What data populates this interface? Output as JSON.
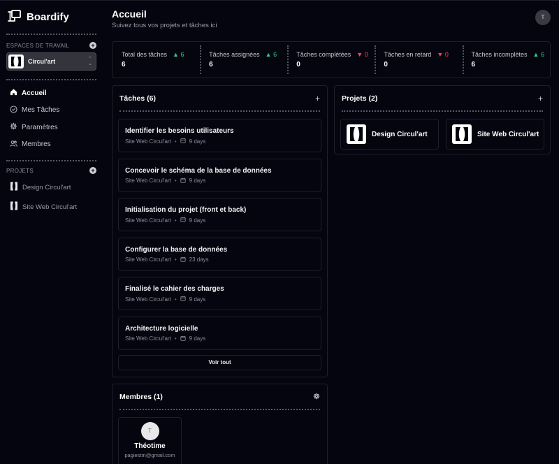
{
  "app": {
    "name": "Boardify"
  },
  "sidebar": {
    "workspaces_label": "ESPACES DE TRAVAIL",
    "workspace": {
      "name": "Circul'art",
      "chevron": "⌃⌄"
    },
    "nav": [
      {
        "label": "Accueil",
        "icon": "home-icon",
        "active": true
      },
      {
        "label": "Mes Tâches",
        "icon": "check-circle-icon",
        "active": false
      },
      {
        "label": "Paramètres",
        "icon": "gear-icon",
        "active": false
      },
      {
        "label": "Membres",
        "icon": "users-icon",
        "active": false
      }
    ],
    "projects_label": "PROJETS",
    "projects": [
      {
        "label": "Design Circul'art"
      },
      {
        "label": "Site Web Circul'art"
      }
    ]
  },
  "header": {
    "title": "Accueil",
    "subtitle": "Suivez tous vos projets et tâches ici",
    "avatar_initial": "T"
  },
  "stats": [
    {
      "label": "Total des tâches",
      "delta": "6",
      "trend": "up",
      "value": "6"
    },
    {
      "label": "Tâches assignées",
      "delta": "6",
      "trend": "up",
      "value": "6"
    },
    {
      "label": "Tâches complétées",
      "delta": "0",
      "trend": "down",
      "value": "0"
    },
    {
      "label": "Tâches en retard",
      "delta": "0",
      "trend": "down",
      "value": "0"
    },
    {
      "label": "Tâches incomplètes",
      "delta": "6",
      "trend": "up",
      "value": "6"
    }
  ],
  "tasks_panel": {
    "title": "Tâches (6)",
    "see_all": "Voir tout",
    "tasks": [
      {
        "title": "Identifier les besoins utilisateurs",
        "project": "Site Web Circul'art",
        "due": "9 days"
      },
      {
        "title": "Concevoir le schéma de la base de données",
        "project": "Site Web Circul'art",
        "due": "9 days"
      },
      {
        "title": "Initialisation du projet (front et back)",
        "project": "Site Web Circul'art",
        "due": "9 days"
      },
      {
        "title": "Configurer la base de données",
        "project": "Site Web Circul'art",
        "due": "23 days"
      },
      {
        "title": "Finalisé le cahier des charges",
        "project": "Site Web Circul'art",
        "due": "9 days"
      },
      {
        "title": "Architecture logicielle",
        "project": "Site Web Circul'art",
        "due": "9 days"
      }
    ]
  },
  "projects_panel": {
    "title": "Projets (2)",
    "projects": [
      {
        "name": "Design Circul'art"
      },
      {
        "name": "Site Web Circul'art"
      }
    ]
  },
  "members_panel": {
    "title": "Membres (1)",
    "members": [
      {
        "initial": "T",
        "name": "Théotime",
        "email": "pagiestm@gmail.com"
      }
    ]
  },
  "colors": {
    "up": "#34c38f",
    "down": "#f0485a",
    "background": "#05050f"
  }
}
